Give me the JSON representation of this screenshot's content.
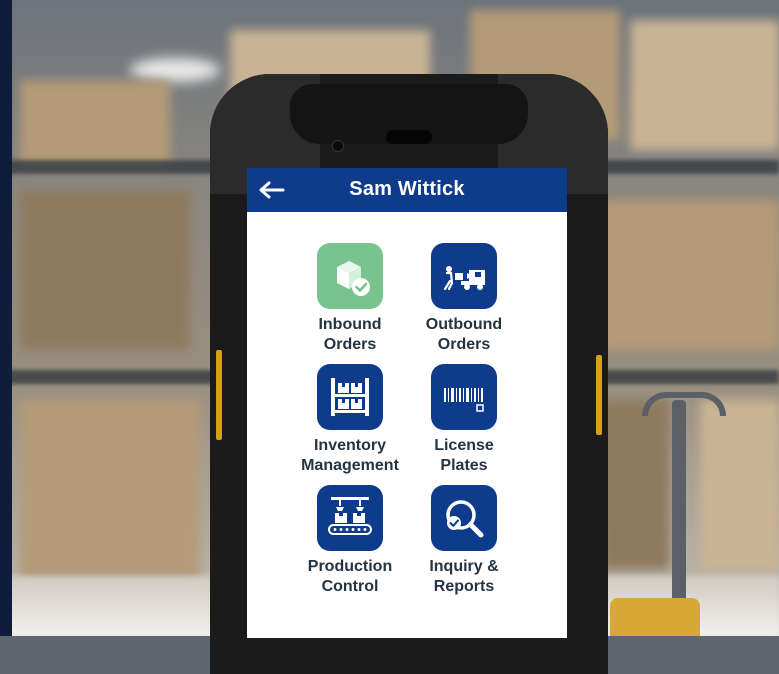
{
  "header": {
    "title": "Sam Wittick",
    "back_icon": "back-arrow-icon"
  },
  "menu": [
    {
      "id": "inbound",
      "label": "Inbound\nOrders",
      "icon": "inbound-box-check-icon",
      "color": "#78c38e"
    },
    {
      "id": "outbound",
      "label": "Outbound\nOrders",
      "icon": "delivery-truck-icon",
      "color": "#0f3b8c"
    },
    {
      "id": "inventory",
      "label": "Inventory\nManagement",
      "icon": "shelving-boxes-icon",
      "color": "#0f3b8c"
    },
    {
      "id": "license",
      "label": "License\nPlates",
      "icon": "barcode-icon",
      "color": "#0f3b8c"
    },
    {
      "id": "production",
      "label": "Production\nControl",
      "icon": "conveyor-icon",
      "color": "#0f3b8c"
    },
    {
      "id": "inquiry",
      "label": "Inquiry &\nReports",
      "icon": "magnifier-check-icon",
      "color": "#0f3b8c"
    }
  ],
  "colors": {
    "header_bg": "#0f3b8c",
    "tile_blue": "#0f3b8c",
    "tile_green": "#78c38e",
    "label_text": "#243442"
  }
}
